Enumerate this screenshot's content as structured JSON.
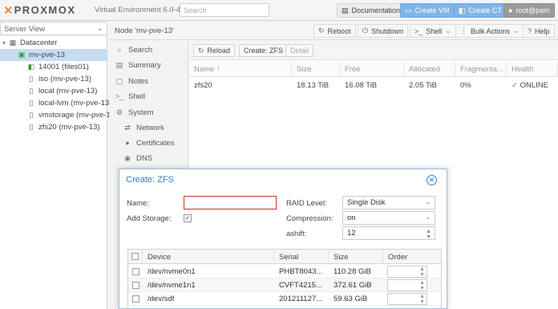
{
  "topbar": {
    "logo": "PROXMOX",
    "version": "Virtual Environment 6.0-4",
    "search_placeholder": "Search",
    "documentation": "Documentation",
    "create_vm": "Create VM",
    "create_ct": "Create CT",
    "user": "root@pam"
  },
  "tree": {
    "view": "Server View",
    "items": [
      {
        "label": "Datacenter",
        "icon": "server-rack-icon"
      },
      {
        "label": "mv-pve-13",
        "icon": "node-icon"
      },
      {
        "label": "14001 (files01)",
        "icon": "container-icon"
      },
      {
        "label": "iso (mv-pve-13)",
        "icon": "storage-icon"
      },
      {
        "label": "local (mv-pve-13)",
        "icon": "storage-icon"
      },
      {
        "label": "local-lvm (mv-pve-13)",
        "icon": "storage-icon"
      },
      {
        "label": "vmstorage (mv-pve-1",
        "icon": "storage-icon"
      },
      {
        "label": "zfs20 (mv-pve-13)",
        "icon": "storage-icon"
      }
    ]
  },
  "node_header": {
    "title": "Node 'mv-pve-13'",
    "reboot": "Reboot",
    "shutdown": "Shutdown",
    "shell": "Shell",
    "bulk_actions": "Bulk Actions",
    "help": "Help"
  },
  "node_menu": {
    "items": [
      "Search",
      "Summary",
      "Notes",
      "Shell",
      "System",
      "Network",
      "Certificates",
      "DNS"
    ]
  },
  "zfs_panel": {
    "reload": "Reload",
    "create": "Create: ZFS",
    "detail": "Detail",
    "columns": [
      "Name ↑",
      "Size",
      "Free",
      "Allocated",
      "Fragmenta...",
      "Health"
    ],
    "rows": [
      {
        "name": "zfs20",
        "size": "18.13 TiB",
        "free": "16.08 TiB",
        "allocated": "2.05 TiB",
        "fragmentation": "0%",
        "health": "ONLINE"
      }
    ]
  },
  "dialog": {
    "title": "Create: ZFS",
    "name_label": "Name:",
    "name_value": "",
    "add_storage_label": "Add Storage:",
    "add_storage_checked": true,
    "raid_label": "RAID Level:",
    "raid_value": "Single Disk",
    "compression_label": "Compression:",
    "compression_value": "on",
    "ashift_label": "ashift:",
    "ashift_value": "12",
    "grid_columns": [
      "Device",
      "Serial",
      "Size",
      "Order"
    ],
    "devices": [
      {
        "device": "/dev/nvme0n1",
        "serial": "PHBT8043...",
        "size": "110.28 GiB"
      },
      {
        "device": "/dev/nvme1n1",
        "serial": "CVFT4215...",
        "size": "372.61 GiB"
      },
      {
        "device": "/dev/sdf",
        "serial": "201211127...",
        "size": "59.63 GiB"
      }
    ]
  },
  "colors": {
    "accent_blue": "#3a7dc4",
    "brand_orange": "#e57000",
    "online_green": "#4caf50",
    "selection": "#c6dcf1"
  }
}
